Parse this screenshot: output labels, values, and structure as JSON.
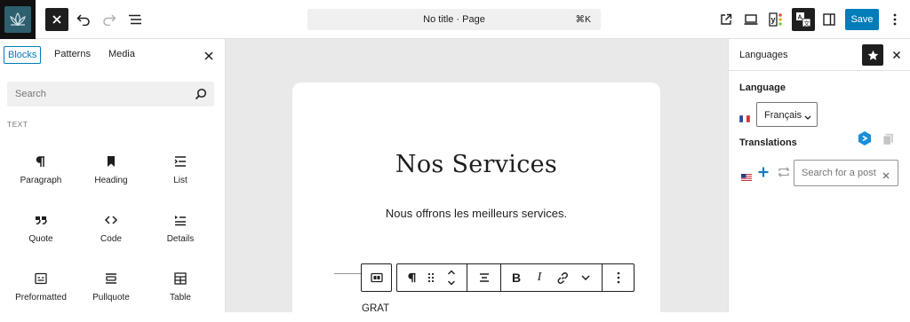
{
  "toolbar": {
    "command_title": "No title · Page",
    "command_shortcut": "⌘K",
    "save_label": "Save",
    "yoast_letter": "y"
  },
  "inserter": {
    "tabs": [
      {
        "label": "Blocks"
      },
      {
        "label": "Patterns"
      },
      {
        "label": "Media"
      }
    ],
    "search_placeholder": "Search",
    "category": "TEXT",
    "blocks": [
      {
        "label": "Paragraph",
        "icon": "paragraph-icon"
      },
      {
        "label": "Heading",
        "icon": "bookmark-icon"
      },
      {
        "label": "List",
        "icon": "list-icon"
      },
      {
        "label": "Quote",
        "icon": "quote-icon"
      },
      {
        "label": "Code",
        "icon": "code-icon"
      },
      {
        "label": "Details",
        "icon": "details-icon"
      },
      {
        "label": "Preformatted",
        "icon": "preformatted-icon"
      },
      {
        "label": "Pullquote",
        "icon": "pullquote-icon"
      },
      {
        "label": "Table",
        "icon": "table-icon"
      }
    ]
  },
  "canvas": {
    "heading": "Nos Services",
    "lead": "Nous offrons les meilleurs services.",
    "partial_text": "GRAT"
  },
  "settings": {
    "title": "Languages",
    "language_label": "Language",
    "language_value": "Français",
    "translations_label": "Translations",
    "post_search_placeholder": "Search for a post"
  },
  "colors": {
    "accent": "#007cba",
    "dark": "#1e1e1e",
    "canvas_bg": "#e9e9e9"
  }
}
